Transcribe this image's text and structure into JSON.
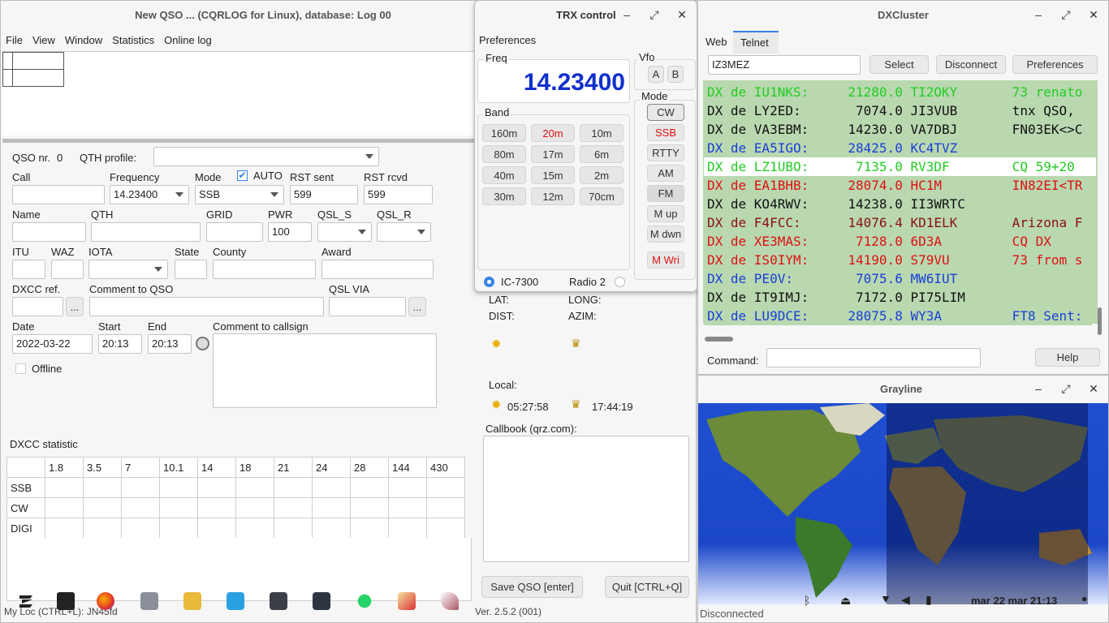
{
  "main": {
    "title": "New QSO ... (CQRLOG for Linux), database: Log 00",
    "menu": [
      "File",
      "View",
      "Window",
      "Statistics",
      "Online log"
    ],
    "qso_nr_label": "QSO nr.",
    "qso_nr": "0",
    "qth_profile_label": "QTH profile:",
    "call_label": "Call",
    "call": "",
    "frequency_label": "Frequency",
    "frequency": "14.23400",
    "mode_label": "Mode",
    "mode": "SSB",
    "auto_label": "AUTO",
    "rst_sent_label": "RST sent",
    "rst_sent": "599",
    "rst_rcvd_label": "RST rcvd",
    "rst_rcvd": "599",
    "name_label": "Name",
    "qth_label": "QTH",
    "grid_label": "GRID",
    "pwr_label": "PWR",
    "pwr": "100",
    "qsl_s_label": "QSL_S",
    "qsl_r_label": "QSL_R",
    "itu_label": "ITU",
    "waz_label": "WAZ",
    "iota_label": "IOTA",
    "state_label": "State",
    "county_label": "County",
    "award_label": "Award",
    "dxcc_ref_label": "DXCC ref.",
    "comment_qso_label": "Comment to QSO",
    "qsl_via_label": "QSL VIA",
    "ellipsis": "...",
    "date_label": "Date",
    "date": "2022-03-22",
    "start_label": "Start",
    "start": "20:13",
    "end_label": "End",
    "end": "20:13",
    "comment_call_label": "Comment to callsign",
    "offline_label": "Offline",
    "dxcc_stat_label": "DXCC statistic",
    "stat_headers": [
      "1.8",
      "3.5",
      "7",
      "10.1",
      "14",
      "18",
      "21",
      "24",
      "28",
      "144",
      "430"
    ],
    "stat_rows": [
      "SSB",
      "CW",
      "DIGI"
    ],
    "lat_label": "LAT:",
    "long_label": "LONG:",
    "dist_label": "DIST:",
    "azim_label": "AZIM:",
    "local_label": "Local:",
    "sunrise": "05:27:58",
    "sunset": "17:44:19",
    "callbook_label": "Callbook (qrz.com):",
    "save_btn": "Save QSO [enter]",
    "quit_btn": "Quit [CTRL+Q]",
    "status_loc": "My Loc (CTRL+L): JN45fd",
    "status_ver": "Ver. 2.5.2 (001)"
  },
  "trx": {
    "title": "TRX control",
    "preferences": "Preferences",
    "freq_label": "Freq",
    "freq": "14.23400",
    "vfo_label": "Vfo",
    "vfo_a": "A",
    "vfo_b": "B",
    "band_label": "Band",
    "bands": [
      "160m",
      "20m",
      "10m",
      "80m",
      "17m",
      "6m",
      "40m",
      "15m",
      "2m",
      "30m",
      "12m",
      "70cm"
    ],
    "mode_label": "Mode",
    "modes": [
      "CW",
      "SSB",
      "RTTY",
      "AM",
      "FM",
      "M up",
      "M dwn",
      "M Wri"
    ],
    "radio1": "IC-7300",
    "radio2": "Radio 2"
  },
  "dxc": {
    "title": "DXCluster",
    "tab_web": "Web",
    "tab_telnet": "Telnet",
    "callsign": "IZ3MEZ",
    "select_btn": "Select",
    "disconnect_btn": "Disconnect",
    "prefs_btn": "Preferences",
    "spots": [
      {
        "text": "DX de IU1NKS:     21280.0 TI2OKY       73 renato",
        "color": "#22cc22",
        "bg": "#b9d8b0"
      },
      {
        "text": "DX de LY2ED:       7074.0 JI3VUB       tnx QSO, ",
        "color": "#111111",
        "bg": "#b9d8b0"
      },
      {
        "text": "DX de VA3EBM:     14230.0 VA7DBJ       FN03EK<>C",
        "color": "#111111",
        "bg": "#b9d8b0"
      },
      {
        "text": "DX de EA5IGO:     28425.0 KC4TVZ",
        "color": "#1a3fd6",
        "bg": "#b9d8b0"
      },
      {
        "text": "DX de LZ1UBO:      7135.0 RV3DF        CQ 59+20",
        "color": "#22cc22",
        "bg": "#ffffff"
      },
      {
        "text": "DX de EA1BHB:     28074.0 HC1M         IN82EI<TR",
        "color": "#dd1111",
        "bg": "#b9d8b0"
      },
      {
        "text": "DX de KO4RWV:     14238.0 II3WRTC",
        "color": "#111111",
        "bg": "#b9d8b0"
      },
      {
        "text": "DX de F4FCC:      14076.4 KD1ELK       Arizona F",
        "color": "#8a1010",
        "bg": "#b9d8b0"
      },
      {
        "text": "DX de XE3MAS:      7128.0 6D3A         CQ DX",
        "color": "#dd1111",
        "bg": "#b9d8b0"
      },
      {
        "text": "DX de IS0IYM:     14190.0 S79VU        73 from s",
        "color": "#dd1111",
        "bg": "#b9d8b0"
      },
      {
        "text": "DX de PE0V:        7075.6 MW6IUT",
        "color": "#1a3fd6",
        "bg": "#b9d8b0"
      },
      {
        "text": "DX de IT9IMJ:      7172.0 PI75LIM",
        "color": "#111111",
        "bg": "#b9d8b0"
      },
      {
        "text": "DX de LU9DCE:     28075.8 WY3A         FT8 Sent:",
        "color": "#1a3fd6",
        "bg": "#b9d8b0"
      }
    ],
    "command_label": "Command:",
    "help_btn": "Help"
  },
  "grayline": {
    "title": "Grayline"
  },
  "status": {
    "disconnected": "Disconnected"
  },
  "panel": {
    "datetime": "mar 22 mar  21:13"
  }
}
